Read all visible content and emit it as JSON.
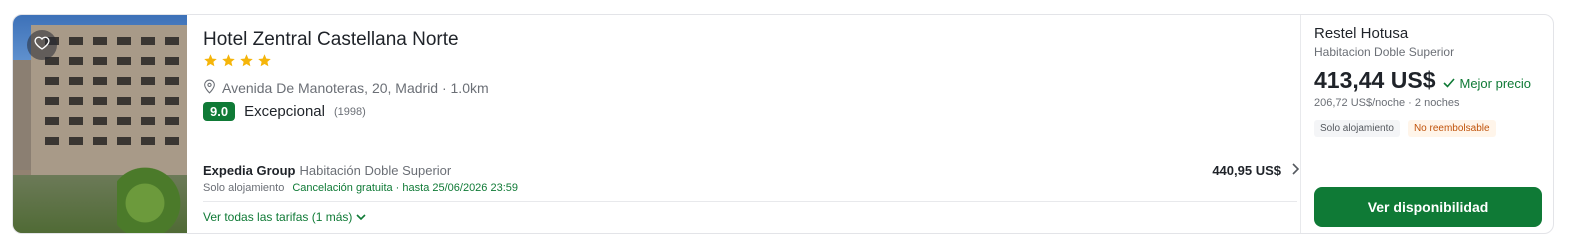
{
  "hotel": {
    "name": "Hotel Zentral Castellana Norte",
    "stars": 4,
    "address": "Avenida De Manoteras, 20, Madrid · 1.0km",
    "rating": {
      "score": "9.0",
      "label": "Excepcional",
      "reviews": "(1998)"
    }
  },
  "offer": {
    "provider": "Expedia Group",
    "room": "Habitación Doble Superior",
    "board": "Solo alojamiento",
    "cancellation": "Cancelación gratuita · hasta 25/06/2026 23:59",
    "price": "440,95 US$"
  },
  "more_rates": "Ver todas las tarifas (1 más)",
  "best_offer": {
    "provider": "Restel Hotusa",
    "room": "Habitacion Doble Superior",
    "price": "413,44 US$",
    "badge": "Mejor precio",
    "per_night": "206,72 US$/noche · 2 noches",
    "tags": [
      "Solo alojamiento",
      "No reembolsable"
    ],
    "cta": "Ver disponibilidad"
  },
  "icons": {
    "favorite": "heart-icon",
    "location": "map-pin-icon",
    "star": "star-icon",
    "chevron_right": "chevron-right-icon",
    "chevron_down": "chevron-down-icon",
    "check": "check-icon"
  },
  "colors": {
    "brand_green": "#0f7a36",
    "star": "#f5b50a",
    "warning": "#c0530a"
  }
}
